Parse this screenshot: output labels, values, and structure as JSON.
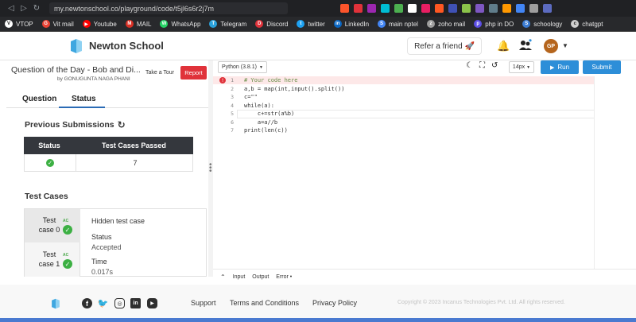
{
  "browser": {
    "url": "my.newtonschool.co/playground/code/t5jl6s6r2j7m",
    "bookmarks": [
      {
        "label": "VTOP",
        "color": "#ffffff",
        "icon": "V"
      },
      {
        "label": "Vit mail",
        "color": "#ea4335",
        "icon": "G"
      },
      {
        "label": "Youtube",
        "color": "#ff0000",
        "icon": "▶"
      },
      {
        "label": "MAIL",
        "color": "#d93025",
        "icon": "M"
      },
      {
        "label": "WhatsApp",
        "color": "#25d366",
        "icon": "W"
      },
      {
        "label": "Telegram",
        "color": "#2aa1da",
        "icon": "T"
      },
      {
        "label": "Discord",
        "color": "#e0323a",
        "icon": "D"
      },
      {
        "label": "twitter",
        "color": "#1da1f2",
        "icon": "t"
      },
      {
        "label": "LinkedIn",
        "color": "#0a66c2",
        "icon": "in"
      },
      {
        "label": "main nptel",
        "color": "#4285f4",
        "icon": "S"
      },
      {
        "label": "zoho mail",
        "color": "#9e9e9e",
        "icon": "z"
      },
      {
        "label": "php in DO",
        "color": "#5c4ee5",
        "icon": "p"
      },
      {
        "label": "schoology",
        "color": "#3b7bd1",
        "icon": "S"
      },
      {
        "label": "chatgpt",
        "color": "#cfcfcf",
        "icon": "c"
      }
    ]
  },
  "header": {
    "brand": "Newton School",
    "refer": "Refer a friend 🚀",
    "avatar": "GP"
  },
  "question": {
    "title": "Question of the Day - Bob and Di...",
    "author": "by GONUGUNTA NAGA PHANI",
    "tour": "Take a Tour",
    "report": "Report",
    "tabs": [
      "Question",
      "Status"
    ]
  },
  "submissions": {
    "title": "Previous Submissions",
    "col_status": "Status",
    "col_passed": "Test Cases Passed",
    "passed": "7"
  },
  "testcases": {
    "title": "Test Cases",
    "items": [
      {
        "name": "Test case 0",
        "badge": "AC"
      },
      {
        "name": "Test case 1",
        "badge": "AC"
      }
    ],
    "hidden": "Hidden test case",
    "status_label": "Status",
    "status_value": "Accepted",
    "time_label": "Time",
    "time_value": "0.017s"
  },
  "editor": {
    "language": "Python (3.8.1)",
    "font_size": "14px",
    "run": "Run",
    "submit": "Submit",
    "lines": [
      "# Your code here",
      "a,b = map(int,input().split())",
      "c=\"\"",
      "while(a):",
      "    c+=str(a%b)",
      "    a=a//b",
      "print(len(c))"
    ]
  },
  "io": {
    "input": "Input",
    "output": "Output",
    "error": "Error •"
  },
  "footer": {
    "support": "Support",
    "terms": "Terms and Conditions",
    "privacy": "Privacy Policy",
    "copyright": "Copyright © 2023 Incanus Technologies Pvt. Ltd. All rights reserved."
  }
}
